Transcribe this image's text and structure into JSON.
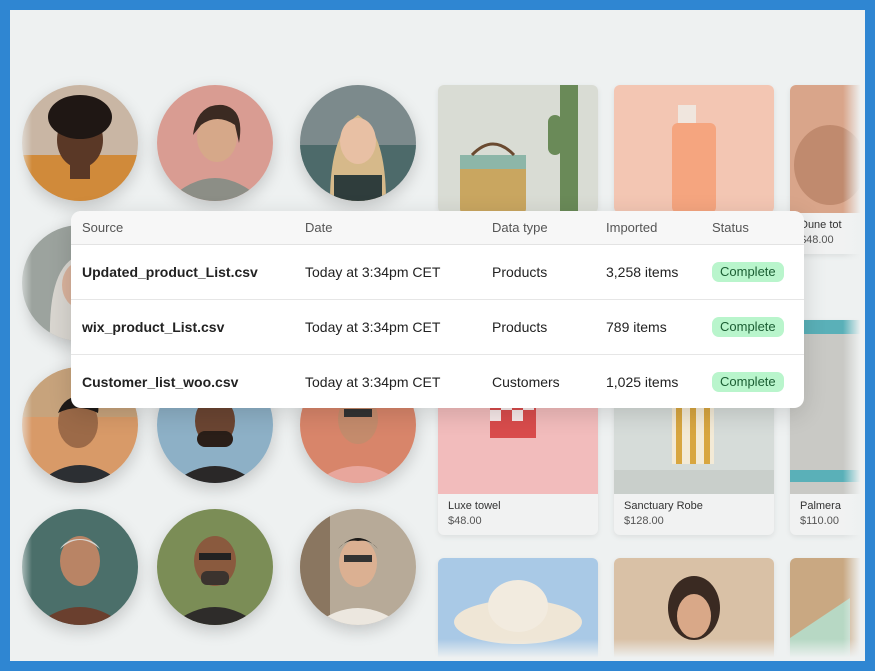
{
  "products": [
    {
      "name": "",
      "price": ""
    },
    {
      "name": "",
      "price": ""
    },
    {
      "name": "Dune tot",
      "price": "$48.00"
    },
    {
      "name": "Luxe towel",
      "price": "$48.00"
    },
    {
      "name": "Sanctuary Robe",
      "price": "$128.00"
    },
    {
      "name": "Palmera",
      "price": "$110.00"
    }
  ],
  "imports_table": {
    "columns": [
      "Source",
      "Date",
      "Data type",
      "Imported",
      "Status"
    ],
    "rows": [
      {
        "source": "Updated_product_List.csv",
        "date": "Today at 3:34pm CET",
        "type": "Products",
        "imported": "3,258 items",
        "status": "Complete"
      },
      {
        "source": "wix_product_List.csv",
        "date": "Today at 3:34pm CET",
        "type": "Products",
        "imported": "789 items",
        "status": "Complete"
      },
      {
        "source": "Customer_list_woo.csv",
        "date": "Today at 3:34pm CET",
        "type": "Customers",
        "imported": "1,025 items",
        "status": "Complete"
      }
    ]
  },
  "colors": {
    "frame": "#2f86d2",
    "badge_bg": "#b9f5cc",
    "badge_text": "#1b5e33"
  }
}
